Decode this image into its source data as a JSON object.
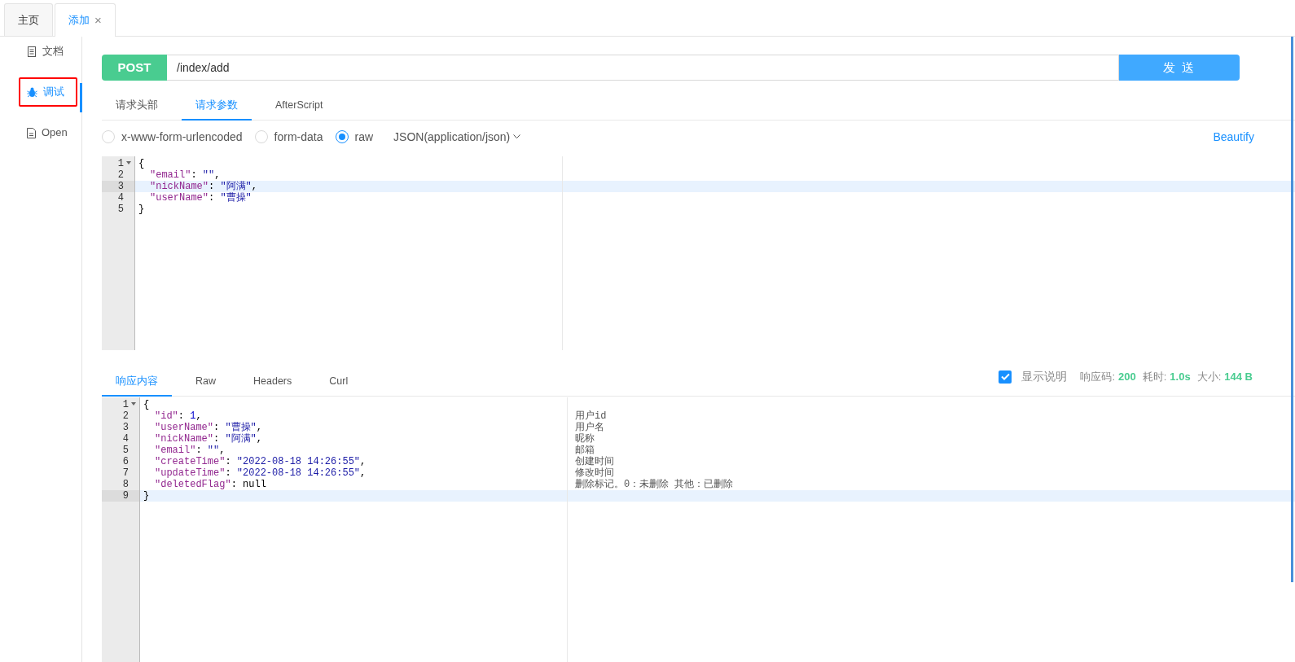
{
  "page_tabs": [
    {
      "label": "主页",
      "selected": false
    },
    {
      "label": "添加",
      "selected": true,
      "close_glyph": "×"
    }
  ],
  "sidebar": {
    "items": [
      {
        "label": "文档",
        "selected": false,
        "outlined": false
      },
      {
        "label": "调试",
        "selected": true,
        "outlined": true
      },
      {
        "label": "Open",
        "selected": false,
        "outlined": false
      }
    ]
  },
  "request": {
    "method": "POST",
    "url": "/index/add",
    "send_button": "发 送"
  },
  "request_tabs": [
    {
      "label": "请求头部",
      "selected": false
    },
    {
      "label": "请求参数",
      "selected": true
    },
    {
      "label": "AfterScript",
      "selected": false
    }
  ],
  "body_types": [
    {
      "label": "x-www-form-urlencoded",
      "selected": false
    },
    {
      "label": "form-data",
      "selected": false
    },
    {
      "label": "raw",
      "selected": true
    }
  ],
  "content_type": "JSON(application/json)",
  "beautify": "Beautify",
  "request_editor": {
    "lines": [
      {
        "number": "1",
        "foldable": true,
        "active": false,
        "tokens": [
          {
            "kind": "plain",
            "text": "{"
          }
        ],
        "children": [
          {
            "number": "2",
            "foldable": false,
            "active": false,
            "tokens": [
              {
                "kind": "key",
                "text": "\"email\""
              },
              {
                "kind": "plain",
                "text": ": "
              },
              {
                "kind": "string",
                "text": "\"\""
              },
              {
                "kind": "plain",
                "text": ","
              }
            ]
          },
          {
            "number": "3",
            "foldable": false,
            "active": true,
            "tokens": [
              {
                "kind": "key",
                "text": "\"nickName\""
              },
              {
                "kind": "plain",
                "text": ": "
              },
              {
                "kind": "string",
                "text": "\"阿满\""
              },
              {
                "kind": "plain",
                "text": ","
              }
            ]
          },
          {
            "number": "4",
            "foldable": false,
            "active": false,
            "tokens": [
              {
                "kind": "key",
                "text": "\"userName\""
              },
              {
                "kind": "plain",
                "text": ": "
              },
              {
                "kind": "string",
                "text": "\"曹操\""
              }
            ]
          }
        ]
      },
      {
        "number": "5",
        "foldable": false,
        "active": false,
        "tokens": [
          {
            "kind": "plain",
            "text": "}"
          }
        ]
      }
    ]
  },
  "response_tabs": [
    {
      "label": "响应内容",
      "selected": true
    },
    {
      "label": "Raw",
      "selected": false
    },
    {
      "label": "Headers",
      "selected": false
    },
    {
      "label": "Curl",
      "selected": false
    }
  ],
  "show_description": {
    "label": "显示说明",
    "checked": true
  },
  "stats": [
    {
      "label": "响应码:",
      "value": "200"
    },
    {
      "label": "耗时:",
      "value": "1.0s"
    },
    {
      "label": "大小:",
      "value": "144 B"
    }
  ],
  "response_editor": {
    "lines": [
      {
        "number": "1",
        "foldable": true,
        "active": false,
        "tokens": [
          {
            "kind": "plain",
            "text": "{"
          }
        ],
        "children": [
          {
            "number": "2",
            "foldable": false,
            "active": false,
            "tokens": [
              {
                "kind": "key",
                "text": "\"id\""
              },
              {
                "kind": "plain",
                "text": ": "
              },
              {
                "kind": "number",
                "text": "1"
              },
              {
                "kind": "plain",
                "text": ","
              }
            ],
            "note": "用户id"
          },
          {
            "number": "3",
            "foldable": false,
            "active": false,
            "tokens": [
              {
                "kind": "key",
                "text": "\"userName\""
              },
              {
                "kind": "plain",
                "text": ": "
              },
              {
                "kind": "string",
                "text": "\"曹操\""
              },
              {
                "kind": "plain",
                "text": ","
              }
            ],
            "note": "用户名"
          },
          {
            "number": "4",
            "foldable": false,
            "active": false,
            "tokens": [
              {
                "kind": "key",
                "text": "\"nickName\""
              },
              {
                "kind": "plain",
                "text": ": "
              },
              {
                "kind": "string",
                "text": "\"阿满\""
              },
              {
                "kind": "plain",
                "text": ","
              }
            ],
            "note": "昵称"
          },
          {
            "number": "5",
            "foldable": false,
            "active": false,
            "tokens": [
              {
                "kind": "key",
                "text": "\"email\""
              },
              {
                "kind": "plain",
                "text": ": "
              },
              {
                "kind": "string",
                "text": "\"\""
              },
              {
                "kind": "plain",
                "text": ","
              }
            ],
            "note": "邮箱"
          },
          {
            "number": "6",
            "foldable": false,
            "active": false,
            "tokens": [
              {
                "kind": "key",
                "text": "\"createTime\""
              },
              {
                "kind": "plain",
                "text": ": "
              },
              {
                "kind": "string",
                "text": "\"2022-08-18 14:26:55\""
              },
              {
                "kind": "plain",
                "text": ","
              }
            ],
            "note": "创建时间"
          },
          {
            "number": "7",
            "foldable": false,
            "active": false,
            "tokens": [
              {
                "kind": "key",
                "text": "\"updateTime\""
              },
              {
                "kind": "plain",
                "text": ": "
              },
              {
                "kind": "string",
                "text": "\"2022-08-18 14:26:55\""
              },
              {
                "kind": "plain",
                "text": ","
              }
            ],
            "note": "修改时间"
          },
          {
            "number": "8",
            "foldable": false,
            "active": false,
            "tokens": [
              {
                "kind": "key",
                "text": "\"deletedFlag\""
              },
              {
                "kind": "plain",
                "text": ": "
              },
              {
                "kind": "plain",
                "text": "null"
              }
            ],
            "note": "删除标记。0：未删除 其他：已删除"
          }
        ]
      },
      {
        "number": "9",
        "foldable": false,
        "active": true,
        "tokens": [
          {
            "kind": "plain",
            "text": "}"
          }
        ]
      }
    ]
  }
}
